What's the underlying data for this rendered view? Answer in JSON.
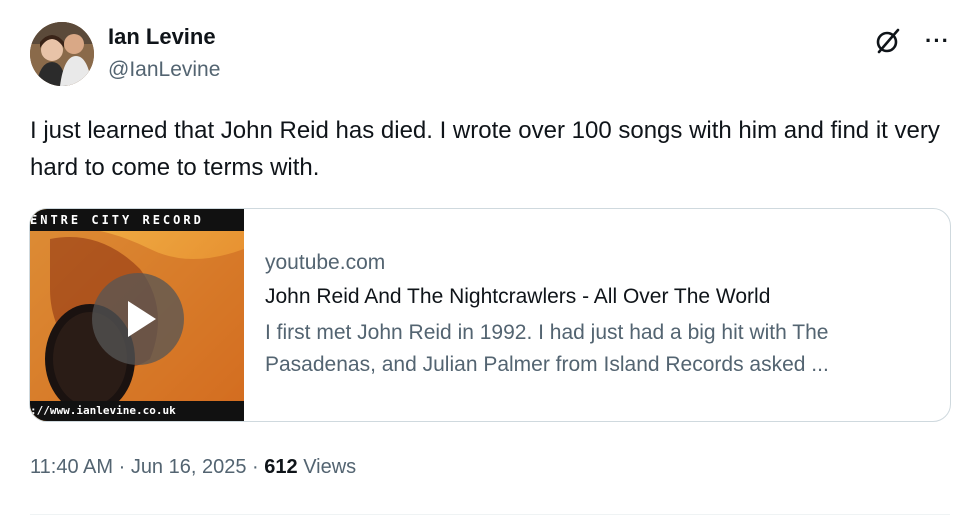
{
  "author": {
    "name": "Ian Levine",
    "handle": "@IanLevine",
    "avatar_icon": "avatar-photo"
  },
  "header_icons": {
    "grok_icon": "grok-slash-circle-icon",
    "more_icon": "more-horizontal-icon",
    "more_glyph": "···"
  },
  "tweet": {
    "text": "I just learned that John Reid has died. I wrote over 100 songs with him and find it very hard to come to terms with."
  },
  "link_card": {
    "thumbnail_top_text": "ENTRE CITY RECORD",
    "thumbnail_bottom_text": "://www.ianlevine.co.uk",
    "play_icon": "play-icon",
    "domain": "youtube.com",
    "title": "John Reid And The Nightcrawlers - All Over The World",
    "description": "I first met John Reid in 1992. I had just had a big hit with The Pasadenas, and Julian Palmer from Island Records asked ..."
  },
  "meta": {
    "time": "11:40 AM",
    "separator": " · ",
    "date": "Jun 16, 2025",
    "views_count": "612",
    "views_label": "Views"
  },
  "colors": {
    "text_primary": "#0f1419",
    "text_secondary": "#536471",
    "card_border": "#cfd9de",
    "thumbnail_orange": "#e9a53b"
  }
}
